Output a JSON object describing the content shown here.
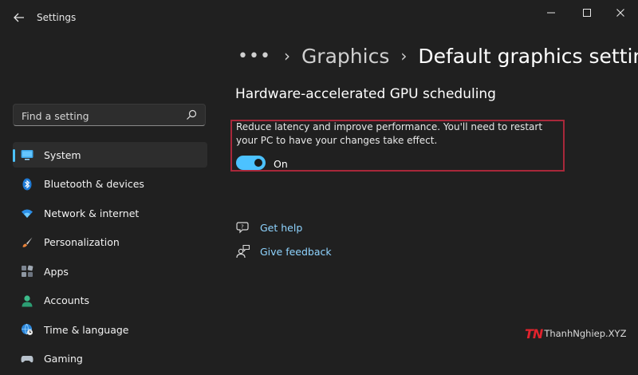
{
  "window": {
    "title": "Settings",
    "back_icon": "arrow-left-icon",
    "controls": [
      "minimize-icon",
      "maximize-icon",
      "close-icon"
    ]
  },
  "search": {
    "placeholder": "Find a setting",
    "value": "",
    "icon": "search-icon"
  },
  "sidebar": {
    "items": [
      {
        "label": "System",
        "icon": "system-monitor-icon",
        "selected": true
      },
      {
        "label": "Bluetooth & devices",
        "icon": "bluetooth-icon",
        "selected": false
      },
      {
        "label": "Network & internet",
        "icon": "wifi-icon",
        "selected": false
      },
      {
        "label": "Personalization",
        "icon": "paintbrush-icon",
        "selected": false
      },
      {
        "label": "Apps",
        "icon": "apps-grid-icon",
        "selected": false
      },
      {
        "label": "Accounts",
        "icon": "person-icon",
        "selected": false
      },
      {
        "label": "Time & language",
        "icon": "globe-clock-icon",
        "selected": false
      },
      {
        "label": "Gaming",
        "icon": "gamepad-icon",
        "selected": false
      }
    ]
  },
  "breadcrumb": {
    "more": "•••",
    "separator": "›",
    "parent": "Graphics",
    "current": "Default graphics settings"
  },
  "main": {
    "section_title": "Hardware-accelerated GPU scheduling",
    "description": "Reduce latency and improve performance. You'll need to restart your PC to have your changes take effect.",
    "toggle": {
      "state": true,
      "label": "On"
    },
    "links": [
      {
        "label": "Get help",
        "icon": "help-chat-icon"
      },
      {
        "label": "Give feedback",
        "icon": "feedback-person-icon"
      }
    ]
  },
  "watermark": {
    "logo": "TN",
    "text": "ThanhNghiep.XYZ"
  },
  "colors": {
    "background": "#202020",
    "accent": "#4cc2ff",
    "link": "#8fd4ff",
    "highlight_border": "#a8283a",
    "watermark_red": "#e0232d"
  }
}
